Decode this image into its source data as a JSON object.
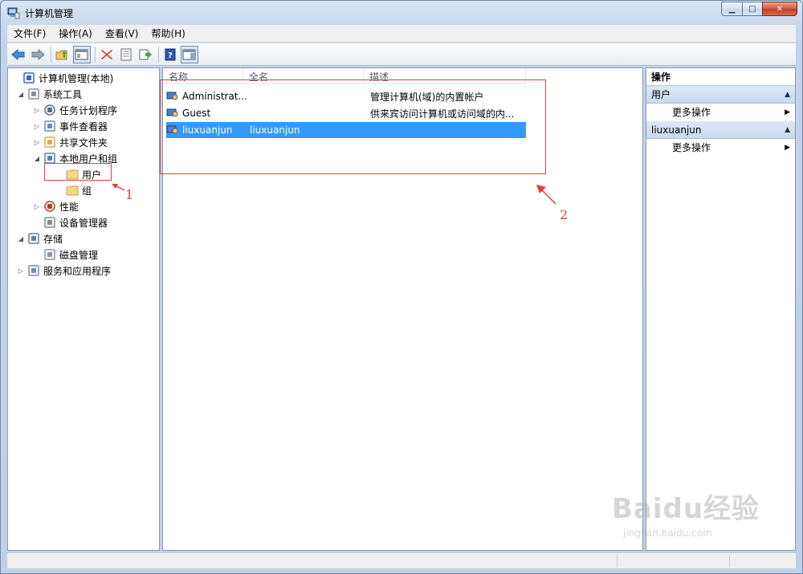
{
  "window": {
    "title": "计算机管理",
    "buttons": {
      "minimize": "▁",
      "maximize": "□",
      "close": "✕"
    }
  },
  "menu": [
    "文件(F)",
    "操作(A)",
    "查看(V)",
    "帮助(H)"
  ],
  "toolbar": {
    "icons": [
      "back-arrow-icon",
      "forward-arrow-icon",
      "up-folder-icon",
      "show-hide-tree-icon",
      "delete-icon",
      "properties-icon",
      "export-list-icon",
      "help-icon",
      "show-action-pane-icon"
    ]
  },
  "tree": [
    {
      "label": "计算机管理(本地)",
      "level": 0,
      "expander": "",
      "icon": "computer-management-icon"
    },
    {
      "label": "系统工具",
      "level": 1,
      "expander": "◢",
      "icon": "tools-icon"
    },
    {
      "label": "任务计划程序",
      "level": 2,
      "expander": "▷",
      "icon": "clock-icon"
    },
    {
      "label": "事件查看器",
      "level": 2,
      "expander": "▷",
      "icon": "event-viewer-icon"
    },
    {
      "label": "共享文件夹",
      "level": 2,
      "expander": "▷",
      "icon": "shared-folder-icon"
    },
    {
      "label": "本地用户和组",
      "level": 2,
      "expander": "◢",
      "icon": "users-group-icon"
    },
    {
      "label": "用户",
      "level": 3,
      "expander": "",
      "icon": "folder-icon"
    },
    {
      "label": "组",
      "level": 3,
      "expander": "",
      "icon": "folder-icon"
    },
    {
      "label": "性能",
      "level": 2,
      "expander": "▷",
      "icon": "performance-icon"
    },
    {
      "label": "设备管理器",
      "level": 2,
      "expander": "",
      "icon": "device-manager-icon"
    },
    {
      "label": "存储",
      "level": 1,
      "expander": "◢",
      "icon": "storage-icon"
    },
    {
      "label": "磁盘管理",
      "level": 2,
      "expander": "",
      "icon": "disk-icon"
    },
    {
      "label": "服务和应用程序",
      "level": 1,
      "expander": "▷",
      "icon": "services-icon"
    }
  ],
  "list": {
    "columns": [
      "名称",
      "全名",
      "描述"
    ],
    "rows": [
      {
        "name": "Administrat...",
        "fullname": "",
        "description": "管理计算机(域)的内置帐户",
        "selected": false
      },
      {
        "name": "Guest",
        "fullname": "",
        "description": "供来宾访问计算机或访问域的内...",
        "selected": false
      },
      {
        "name": "liuxuanjun",
        "fullname": "liuxuanjun",
        "description": "",
        "selected": true
      }
    ]
  },
  "actions": {
    "title": "操作",
    "groups": [
      {
        "label": "用户",
        "item": "更多操作"
      },
      {
        "label": "liuxuanjun",
        "item": "更多操作"
      }
    ]
  },
  "annotations": {
    "one": "1",
    "two": "2"
  },
  "watermark": {
    "main": "Baidu经验",
    "sub": "jingyan.baidu.com"
  },
  "colors": {
    "annotation": "#e2403c",
    "selection": "#3399ff"
  }
}
